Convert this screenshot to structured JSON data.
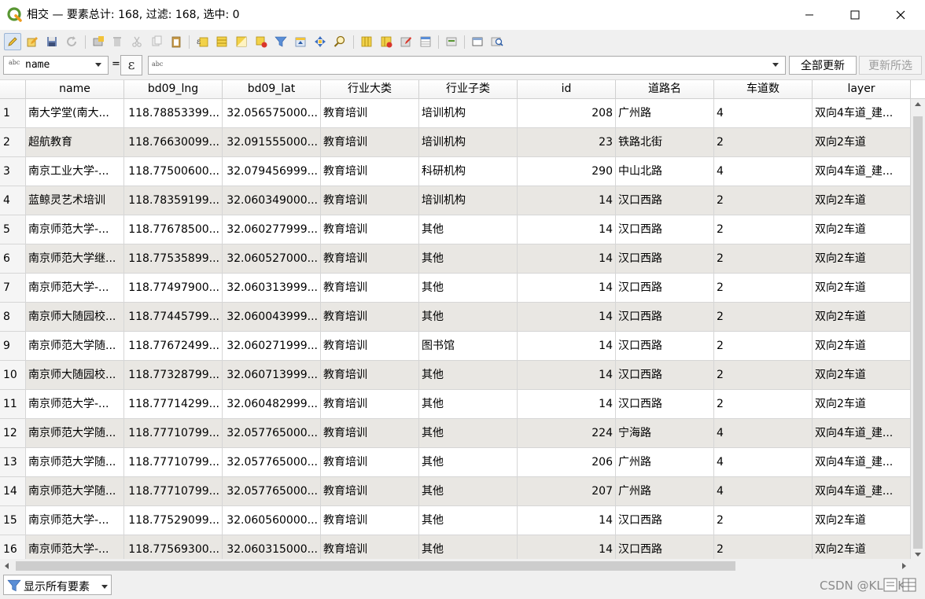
{
  "window": {
    "title": "相交 — 要素总计: 168, 过滤: 168, 选中: 0"
  },
  "toolbar": {
    "icons": [
      "edit-pencil-icon",
      "multi-edit-icon",
      "save-icon",
      "reload-icon",
      "add-feature-icon",
      "delete-icon",
      "cut-icon",
      "copy-icon",
      "paste-icon",
      "select-by-expression-icon",
      "select-all-icon",
      "invert-selection-icon",
      "deselect-icon",
      "filter-icon",
      "move-selection-top-icon",
      "pan-to-selection-icon",
      "zoom-to-selection-icon",
      "new-field-icon",
      "delete-field-icon",
      "field-calculator-icon",
      "conditional-format-icon",
      "actions-icon",
      "dock-icon",
      "zoom-icon"
    ]
  },
  "exprbar": {
    "field_type": "abc",
    "field_name": "name",
    "equals": "=",
    "epsilon": "ε",
    "value_type": "abc",
    "update_all": "全部更新",
    "update_selected": "更新所选"
  },
  "table": {
    "columns": [
      "name",
      "bd09_lng",
      "bd09_lat",
      "行业大类",
      "行业子类",
      "id",
      "道路名",
      "车道数",
      "layer"
    ],
    "rows": [
      {
        "n": "1",
        "name": "南大学堂(南大...",
        "lng": "118.78853399...",
        "lat": "32.056575000...",
        "major": "教育培训",
        "minor": "培训机构",
        "id": "208",
        "road": "广州路",
        "lanes": "4",
        "layer": "双向4车道_建..."
      },
      {
        "n": "2",
        "name": "超航教育",
        "lng": "118.76630099...",
        "lat": "32.091555000...",
        "major": "教育培训",
        "minor": "培训机构",
        "id": "23",
        "road": "铁路北街",
        "lanes": "2",
        "layer": "双向2车道"
      },
      {
        "n": "3",
        "name": "南京工业大学-...",
        "lng": "118.77500600...",
        "lat": "32.079456999...",
        "major": "教育培训",
        "minor": "科研机构",
        "id": "290",
        "road": "中山北路",
        "lanes": "4",
        "layer": "双向4车道_建..."
      },
      {
        "n": "4",
        "name": "蓝鲸灵艺术培训",
        "lng": "118.78359199...",
        "lat": "32.060349000...",
        "major": "教育培训",
        "minor": "培训机构",
        "id": "14",
        "road": "汉口西路",
        "lanes": "2",
        "layer": "双向2车道"
      },
      {
        "n": "5",
        "name": "南京师范大学-...",
        "lng": "118.77678500...",
        "lat": "32.060277999...",
        "major": "教育培训",
        "minor": "其他",
        "id": "14",
        "road": "汉口西路",
        "lanes": "2",
        "layer": "双向2车道"
      },
      {
        "n": "6",
        "name": "南京师范大学继...",
        "lng": "118.77535899...",
        "lat": "32.060527000...",
        "major": "教育培训",
        "minor": "其他",
        "id": "14",
        "road": "汉口西路",
        "lanes": "2",
        "layer": "双向2车道"
      },
      {
        "n": "7",
        "name": "南京师范大学-...",
        "lng": "118.77497900...",
        "lat": "32.060313999...",
        "major": "教育培训",
        "minor": "其他",
        "id": "14",
        "road": "汉口西路",
        "lanes": "2",
        "layer": "双向2车道"
      },
      {
        "n": "8",
        "name": "南京师大随园校...",
        "lng": "118.77445799...",
        "lat": "32.060043999...",
        "major": "教育培训",
        "minor": "其他",
        "id": "14",
        "road": "汉口西路",
        "lanes": "2",
        "layer": "双向2车道"
      },
      {
        "n": "9",
        "name": "南京师范大学随...",
        "lng": "118.77672499...",
        "lat": "32.060271999...",
        "major": "教育培训",
        "minor": "图书馆",
        "id": "14",
        "road": "汉口西路",
        "lanes": "2",
        "layer": "双向2车道"
      },
      {
        "n": "10",
        "name": "南京师大随园校...",
        "lng": "118.77328799...",
        "lat": "32.060713999...",
        "major": "教育培训",
        "minor": "其他",
        "id": "14",
        "road": "汉口西路",
        "lanes": "2",
        "layer": "双向2车道"
      },
      {
        "n": "11",
        "name": "南京师范大学-...",
        "lng": "118.77714299...",
        "lat": "32.060482999...",
        "major": "教育培训",
        "minor": "其他",
        "id": "14",
        "road": "汉口西路",
        "lanes": "2",
        "layer": "双向2车道"
      },
      {
        "n": "12",
        "name": "南京师范大学随...",
        "lng": "118.77710799...",
        "lat": "32.057765000...",
        "major": "教育培训",
        "minor": "其他",
        "id": "224",
        "road": "宁海路",
        "lanes": "4",
        "layer": "双向4车道_建..."
      },
      {
        "n": "13",
        "name": "南京师范大学随...",
        "lng": "118.77710799...",
        "lat": "32.057765000...",
        "major": "教育培训",
        "minor": "其他",
        "id": "206",
        "road": "广州路",
        "lanes": "4",
        "layer": "双向4车道_建..."
      },
      {
        "n": "14",
        "name": "南京师范大学随...",
        "lng": "118.77710799...",
        "lat": "32.057765000...",
        "major": "教育培训",
        "minor": "其他",
        "id": "207",
        "road": "广州路",
        "lanes": "4",
        "layer": "双向4车道_建..."
      },
      {
        "n": "15",
        "name": "南京师范大学-...",
        "lng": "118.77529099...",
        "lat": "32.060560000...",
        "major": "教育培训",
        "minor": "其他",
        "id": "14",
        "road": "汉口西路",
        "lanes": "2",
        "layer": "双向2车道"
      },
      {
        "n": "16",
        "name": "南京师范大学-...",
        "lng": "118.77569300...",
        "lat": "32.060315000...",
        "major": "教育培训",
        "minor": "其他",
        "id": "14",
        "road": "汉口西路",
        "lanes": "2",
        "layer": "双向2车道"
      }
    ]
  },
  "status": {
    "filter_label": "显示所有要素",
    "watermark": "CSDN @KLKFKM"
  },
  "colors": {
    "alt_row": "#e9e7e3",
    "qgis_green": "#589632",
    "qgis_yellow": "#ee9b1d"
  }
}
